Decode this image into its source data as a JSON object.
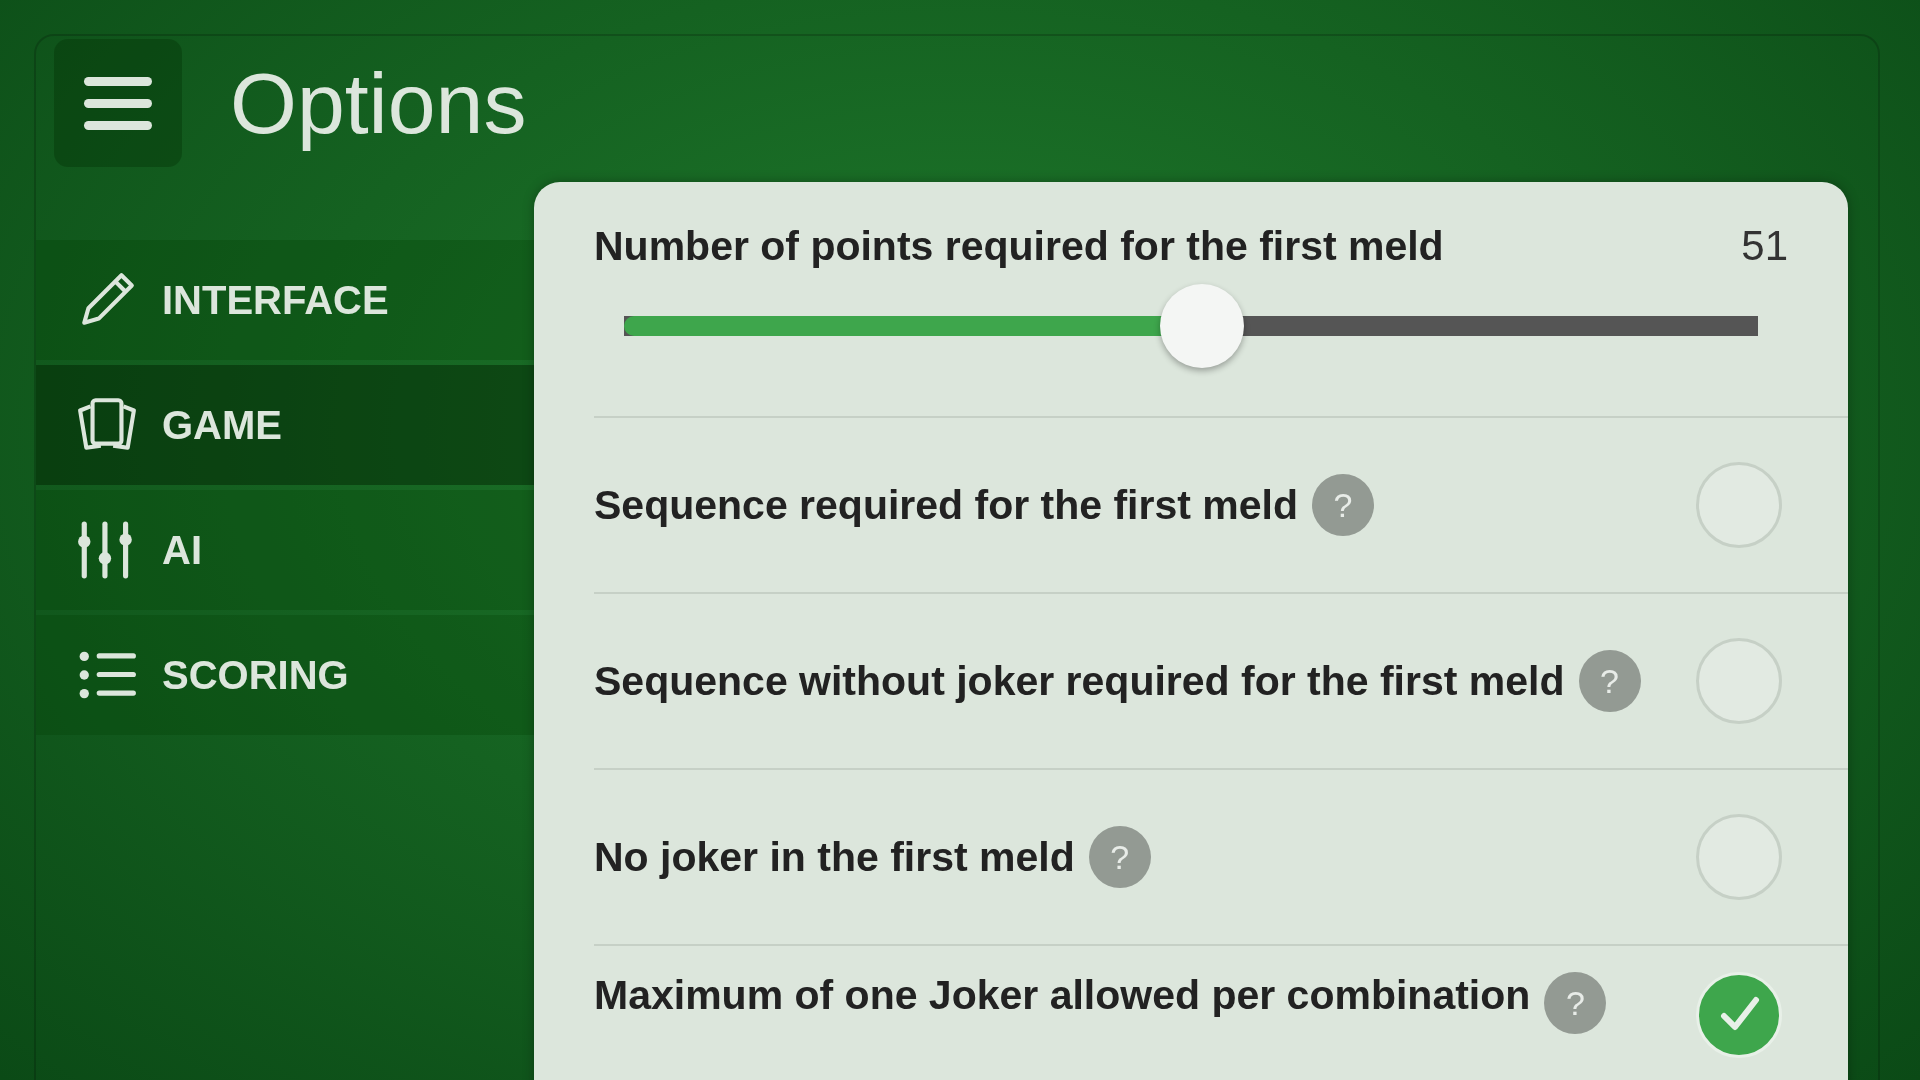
{
  "header": {
    "title": "Options"
  },
  "sidebar": {
    "items": [
      {
        "label": "INTERFACE",
        "kind": "pencil",
        "selected": false
      },
      {
        "label": "GAME",
        "kind": "cards",
        "selected": true
      },
      {
        "label": "AI",
        "kind": "sliders",
        "selected": false
      },
      {
        "label": "SCORING",
        "kind": "list",
        "selected": false
      }
    ]
  },
  "settings": [
    {
      "kind": "slider",
      "label": "Number of points required for the first meld",
      "reading": "51",
      "level": 0.51
    },
    {
      "kind": "toggle",
      "label": "Sequence required for the first meld",
      "help": "?",
      "checked": false
    },
    {
      "kind": "toggle",
      "label": "Sequence without joker required for the first meld",
      "help": "?",
      "checked": false
    },
    {
      "kind": "toggle",
      "label": "No joker in the first meld",
      "help": "?",
      "checked": false
    },
    {
      "kind": "toggle",
      "label": "Maximum of one Joker allowed per combination",
      "help": "?",
      "checked": true
    }
  ]
}
